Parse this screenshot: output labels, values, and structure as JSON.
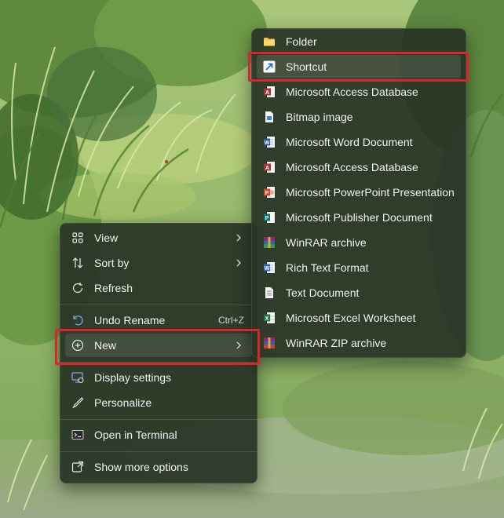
{
  "context_menu": {
    "items": [
      {
        "label": "View",
        "icon": "grid-view-icon"
      },
      {
        "label": "Sort by",
        "icon": "sort-arrows-icon"
      },
      {
        "label": "Refresh",
        "icon": "refresh-icon"
      },
      {
        "label": "Undo Rename",
        "icon": "undo-icon",
        "accelerator": "Ctrl+Z"
      },
      {
        "label": "New",
        "icon": "add-circle-icon"
      },
      {
        "label": "Display settings",
        "icon": "display-settings-icon"
      },
      {
        "label": "Personalize",
        "icon": "pen-icon"
      },
      {
        "label": "Open in Terminal",
        "icon": "terminal-icon"
      },
      {
        "label": "Show more options",
        "icon": "share-external-icon"
      }
    ]
  },
  "new_submenu": {
    "items": [
      {
        "label": "Folder",
        "icon": "folder-icon"
      },
      {
        "label": "Shortcut",
        "icon": "shortcut-arrow-icon"
      },
      {
        "label": "Microsoft Access Database",
        "icon": "access-icon"
      },
      {
        "label": "Bitmap image",
        "icon": "bitmap-icon"
      },
      {
        "label": "Microsoft Word Document",
        "icon": "word-icon"
      },
      {
        "label": "Microsoft Access Database",
        "icon": "access-icon"
      },
      {
        "label": "Microsoft PowerPoint Presentation",
        "icon": "powerpoint-icon"
      },
      {
        "label": "Microsoft Publisher Document",
        "icon": "publisher-icon"
      },
      {
        "label": "WinRAR archive",
        "icon": "winrar-icon"
      },
      {
        "label": "Rich Text Format",
        "icon": "wordpad-icon"
      },
      {
        "label": "Text Document",
        "icon": "text-document-icon"
      },
      {
        "label": "Microsoft Excel Worksheet",
        "icon": "excel-icon"
      },
      {
        "label": "WinRAR ZIP archive",
        "icon": "winrar-zip-icon"
      }
    ]
  },
  "highlight_color": "#d8262b"
}
